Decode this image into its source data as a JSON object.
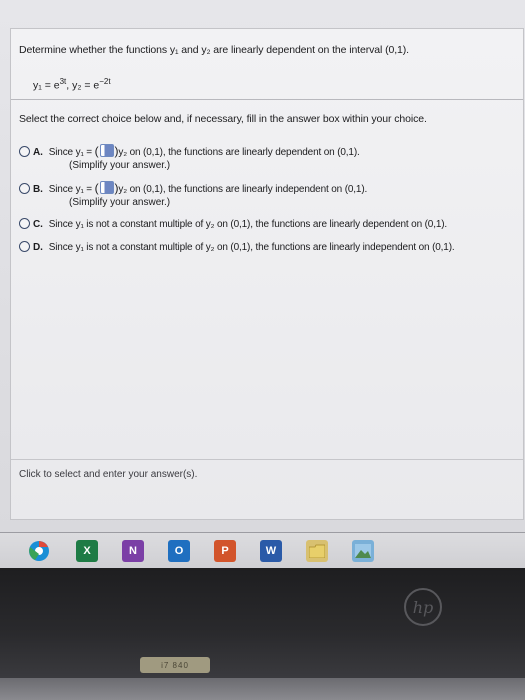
{
  "question": {
    "text": "Determine whether the functions y₁ and y₂ are linearly dependent on the interval (0,1).",
    "y1_base": "y₁ = e",
    "y1_exp": "3t",
    "y2_base": ", y₂ = e",
    "y2_exp": "−2t"
  },
  "instruction": "Select the correct choice below and, if necessary, fill in the answer box within your choice.",
  "choices": [
    {
      "letter": "A.",
      "pre": "Since y₁ =",
      "post": "y₂ on (0,1), the functions are linearly dependent on (0,1).",
      "note": "(Simplify your answer.)"
    },
    {
      "letter": "B.",
      "pre": "Since y₁ =",
      "post": "y₂ on (0,1), the functions are linearly independent on (0,1).",
      "note": "(Simplify your answer.)"
    },
    {
      "letter": "C.",
      "text": "Since y₁ is not a constant multiple of y₂ on (0,1), the functions are linearly dependent on (0,1)."
    },
    {
      "letter": "D.",
      "text": "Since y₁ is not a constant multiple of y₂ on (0,1), the functions are linearly independent on (0,1)."
    }
  ],
  "hint": "Click to select and enter your answer(s).",
  "taskbar": {
    "excel_label": "X",
    "onenote_label": "N",
    "outlook_label": "O",
    "powerpoint_label": "P",
    "word_label": "W"
  },
  "hardware": {
    "brand": "hp",
    "sticker": "i7 840"
  },
  "colors": {
    "chrome": "#1a8fd6",
    "excel": "#1e7b45",
    "onenote": "#7b3fa6",
    "outlook": "#1f6fc0",
    "powerpoint": "#d2542b",
    "word": "#2a5aa8"
  }
}
